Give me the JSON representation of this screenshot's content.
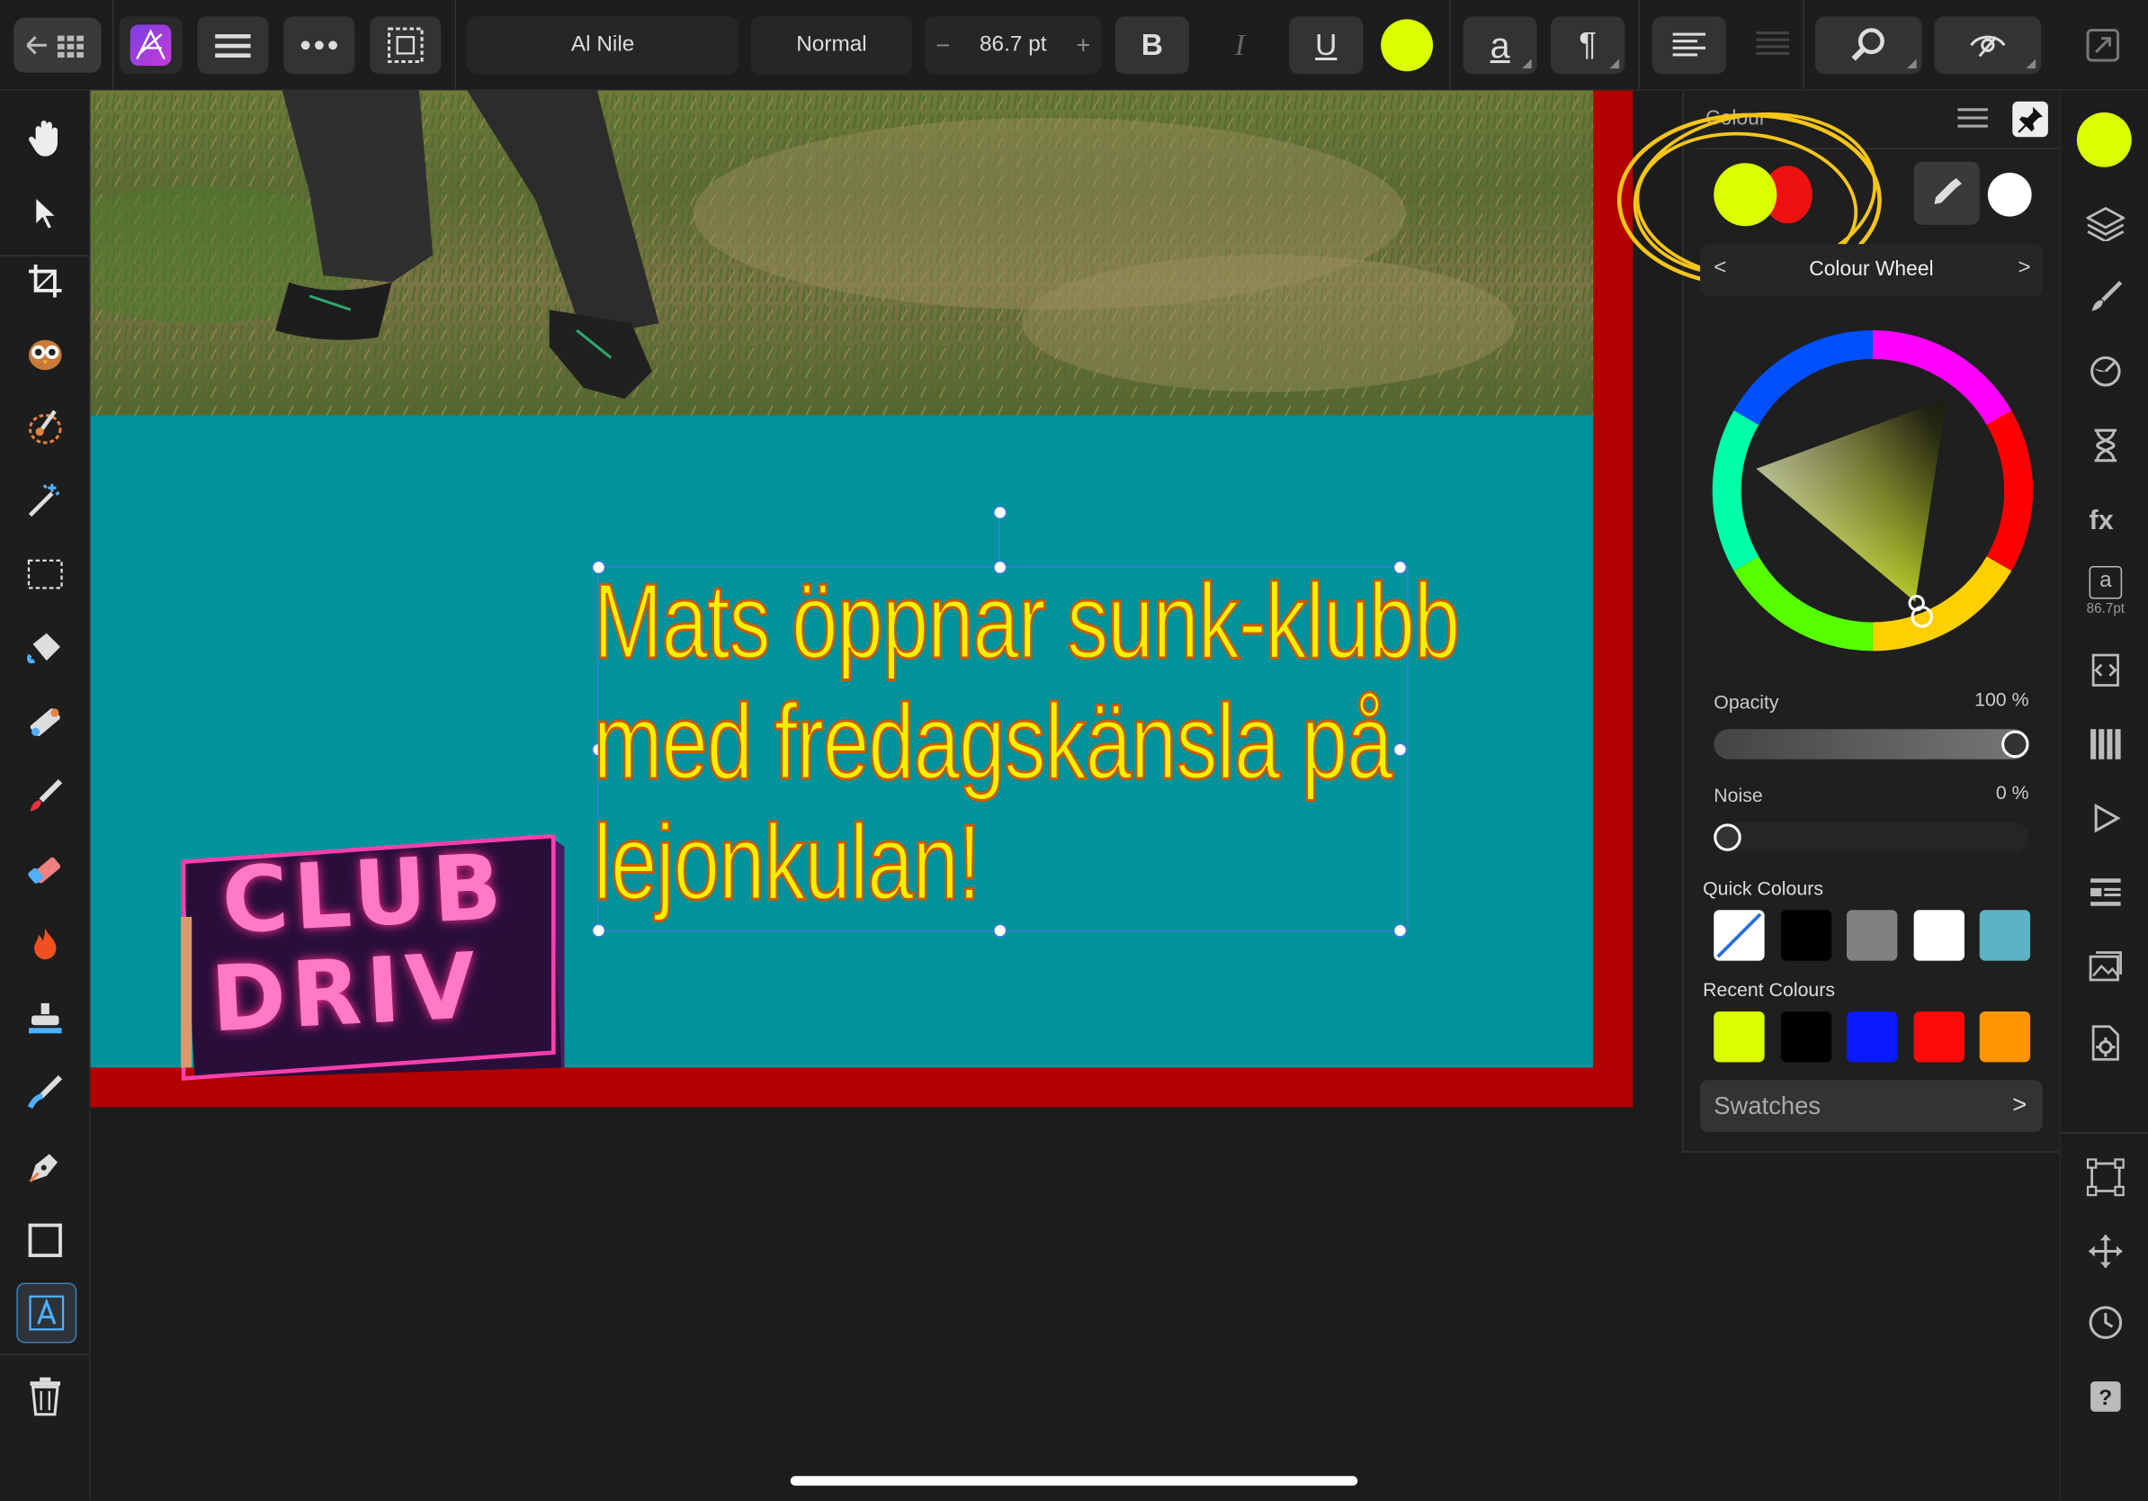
{
  "toolbar": {
    "font_name": "Al Nile",
    "font_style": "Normal",
    "font_size": "86.7 pt",
    "minus": "−",
    "plus": "+",
    "bold": "B",
    "italic": "I",
    "underline": "U",
    "fill_color": "#d9ff00",
    "text_a": "a",
    "pilcrow": "¶"
  },
  "canvas": {
    "headline_lines": [
      "Mats öppnar sunk-klubb",
      "med fredagskänsla på",
      "lejonkulan!"
    ],
    "sign_line1": "CLUB",
    "sign_line2": "DRIV",
    "text_color": "#f2f200",
    "bg_color": "#00939c",
    "border_color": "#b30000"
  },
  "panel": {
    "title": "Colour",
    "mode_label": "Colour Wheel",
    "primary_color": "#d9ff00",
    "secondary_color": "#ee1111",
    "opacity_label": "Opacity",
    "opacity_value": "100 %",
    "opacity_fraction": 1.0,
    "noise_label": "Noise",
    "noise_value": "0 %",
    "noise_fraction": 0.0,
    "quick_label": "Quick Colours",
    "quick_colours": [
      "none",
      "#000000",
      "#808080",
      "#ffffff",
      "#5bb3c4"
    ],
    "recent_label": "Recent Colours",
    "recent_colours": [
      "#d9ff00",
      "#000000",
      "#0a1aff",
      "#ff0a0a",
      "#ff9500"
    ],
    "swatches_label": "Swatches",
    "back_chevron": "<",
    "forward_chevron": ">"
  },
  "right_strip": {
    "current_color": "#d9ff00",
    "text_size_label": "86.7pt",
    "text_icon": "a"
  }
}
